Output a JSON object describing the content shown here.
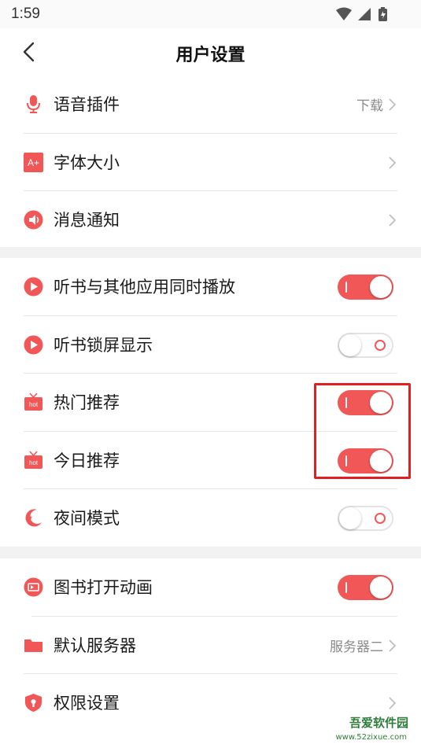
{
  "status_bar": {
    "time": "1:59"
  },
  "header": {
    "title": "用户设置"
  },
  "group1": [
    {
      "label": "语音插件",
      "value": "下载",
      "icon": "microphone-icon"
    },
    {
      "label": "字体大小",
      "value": "",
      "icon": "font-size-icon"
    },
    {
      "label": "消息通知",
      "value": "",
      "icon": "notification-icon"
    }
  ],
  "group2": [
    {
      "label": "听书与其他应用同时播放",
      "state": "on",
      "icon": "play-icon"
    },
    {
      "label": "听书锁屏显示",
      "state": "off",
      "icon": "play-icon"
    },
    {
      "label": "热门推荐",
      "state": "on",
      "icon": "hot-tv-icon"
    },
    {
      "label": "今日推荐",
      "state": "on",
      "icon": "hot-tv-icon"
    },
    {
      "label": "夜间模式",
      "state": "off",
      "icon": "moon-icon"
    }
  ],
  "group3": [
    {
      "label": "图书打开动画",
      "state": "on",
      "icon": "book-animation-icon"
    },
    {
      "label": "默认服务器",
      "value": "服务器二",
      "icon": "folder-icon"
    },
    {
      "label": "权限设置",
      "value": "",
      "icon": "shield-icon"
    }
  ],
  "icon_labels": {
    "font_icon_text": "A+",
    "hot_icon_text": "hot"
  },
  "watermark": {
    "text": "吾爱软件园",
    "url": "www.52zixue.com"
  },
  "colors": {
    "accent": "#f25757",
    "highlight": "#e02020"
  }
}
